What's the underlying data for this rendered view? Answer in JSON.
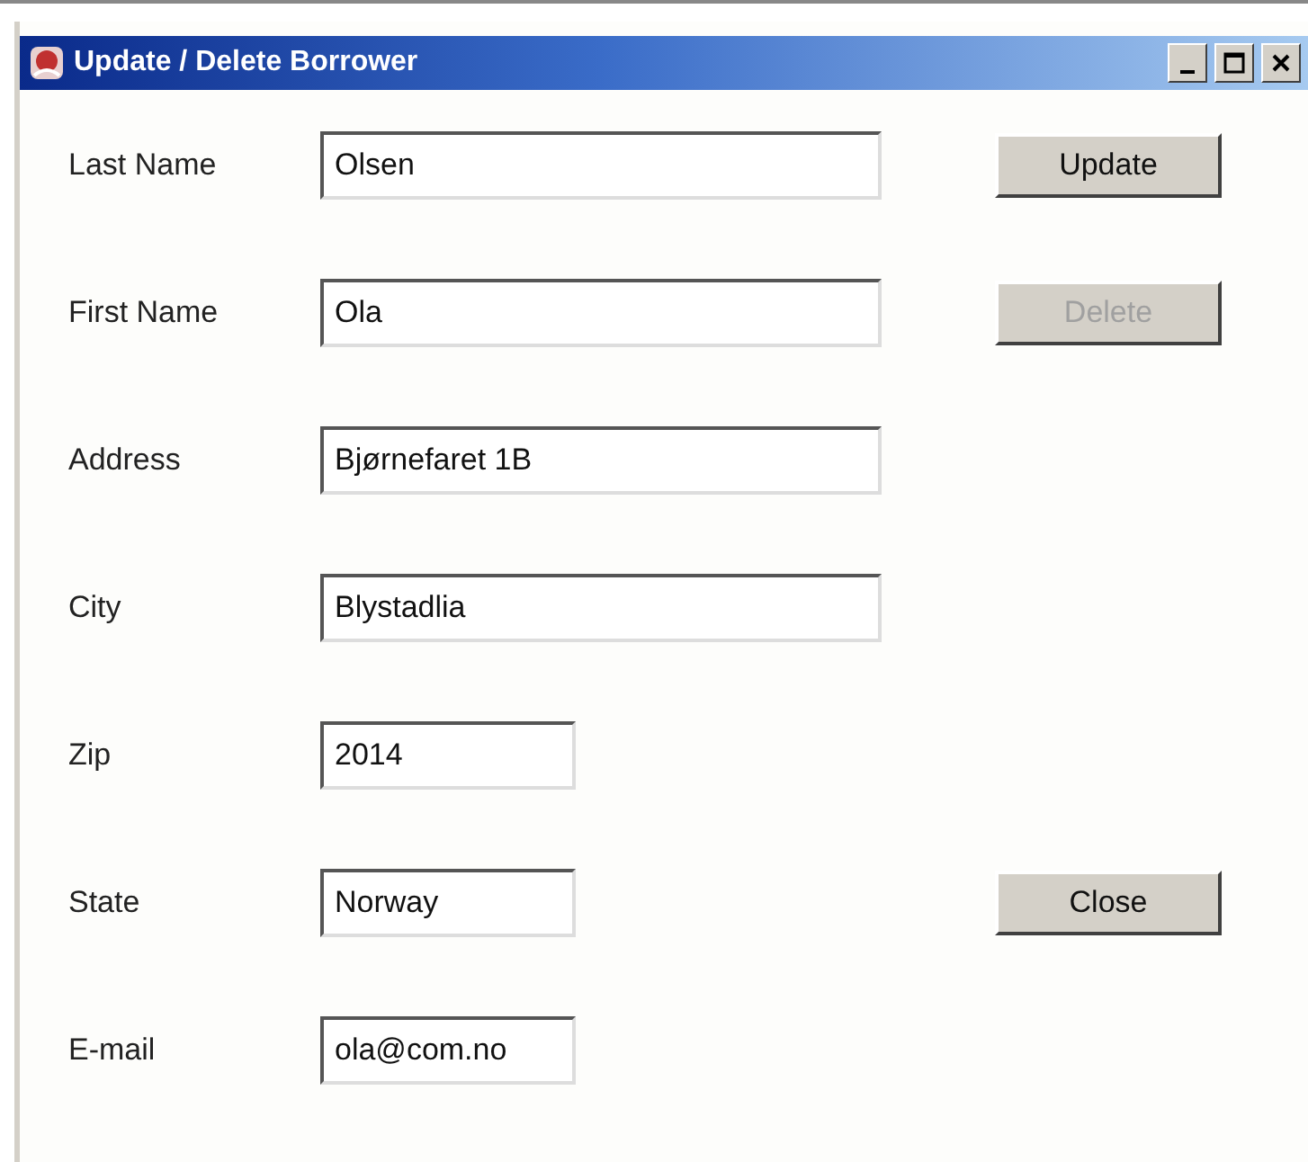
{
  "window": {
    "title": "Update / Delete Borrower"
  },
  "rows": [
    {
      "label": "Last Name",
      "value": "Olsen",
      "kind": "wide",
      "button": {
        "label": "Update",
        "disabled": false
      }
    },
    {
      "label": "First Name",
      "value": "Ola",
      "kind": "wide",
      "button": {
        "label": "Delete",
        "disabled": true
      }
    },
    {
      "label": "Address",
      "value": "Bjørnefaret 1B",
      "kind": "wide"
    },
    {
      "label": "City",
      "value": "Blystadlia",
      "kind": "wide"
    },
    {
      "label": "Zip",
      "value": "2014",
      "kind": "narrow"
    },
    {
      "label": "State",
      "value": "Norway",
      "kind": "narrow",
      "button": {
        "label": "Close",
        "disabled": false
      }
    },
    {
      "label": "E-mail",
      "value": "ola@com.no",
      "kind": "narrow"
    }
  ]
}
